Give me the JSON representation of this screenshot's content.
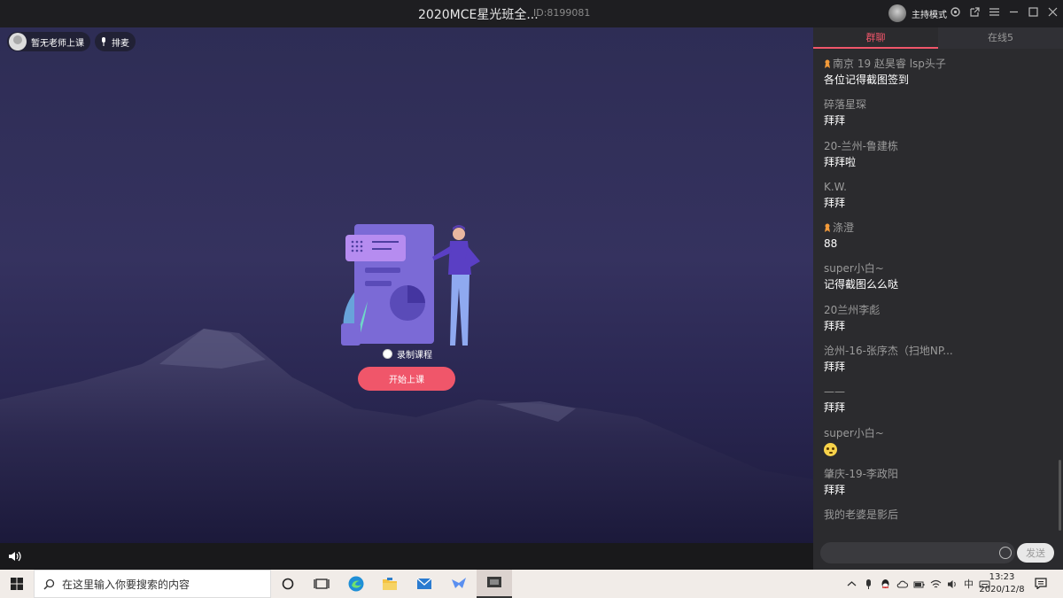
{
  "window": {
    "title": "2020MCE星光班全...",
    "room_id": "ID:8199081",
    "host_mode_label": "主持模式"
  },
  "stage": {
    "teacher_label": "暂无老师上课",
    "mic_order_label": "排麦",
    "record_label": "录制课程",
    "start_button": "开始上课"
  },
  "chat": {
    "tabs": [
      {
        "label": "群聊",
        "active": true
      },
      {
        "label": "在线5",
        "active": false
      }
    ],
    "messages": [
      {
        "name": "南京 19 赵昊睿 lsp头子",
        "text": "各位记得截图签到",
        "badge": true
      },
      {
        "name": "碎落星琛",
        "text": "拜拜",
        "badge": false
      },
      {
        "name": "20-兰州-鲁建栋",
        "text": "拜拜啦",
        "badge": false
      },
      {
        "name": "K.W.",
        "text": "拜拜",
        "badge": false
      },
      {
        "name": "涤澄",
        "text": "88",
        "badge": true
      },
      {
        "name": "super小白~",
        "text": "记得截图么么哒",
        "badge": false
      },
      {
        "name": "20兰州李彪",
        "text": "拜拜",
        "badge": false
      },
      {
        "name": "沧州-16-张序杰（扫地NP...",
        "text": "拜拜",
        "badge": false
      },
      {
        "name": "——",
        "text": "拜拜",
        "badge": false
      },
      {
        "name": "super小白~",
        "text": "",
        "badge": false,
        "emoji": "thinking-face"
      },
      {
        "name": "肇庆-19-李政阳",
        "text": "拜拜",
        "badge": false
      },
      {
        "name": "我的老婆是影后",
        "text": "",
        "badge": false
      }
    ],
    "send_label": "发送",
    "input_value": ""
  },
  "taskbar": {
    "search_placeholder": "在这里输入你要搜索的内容",
    "ime_label": "中",
    "time": "13:23",
    "date": "2020/12/8"
  }
}
